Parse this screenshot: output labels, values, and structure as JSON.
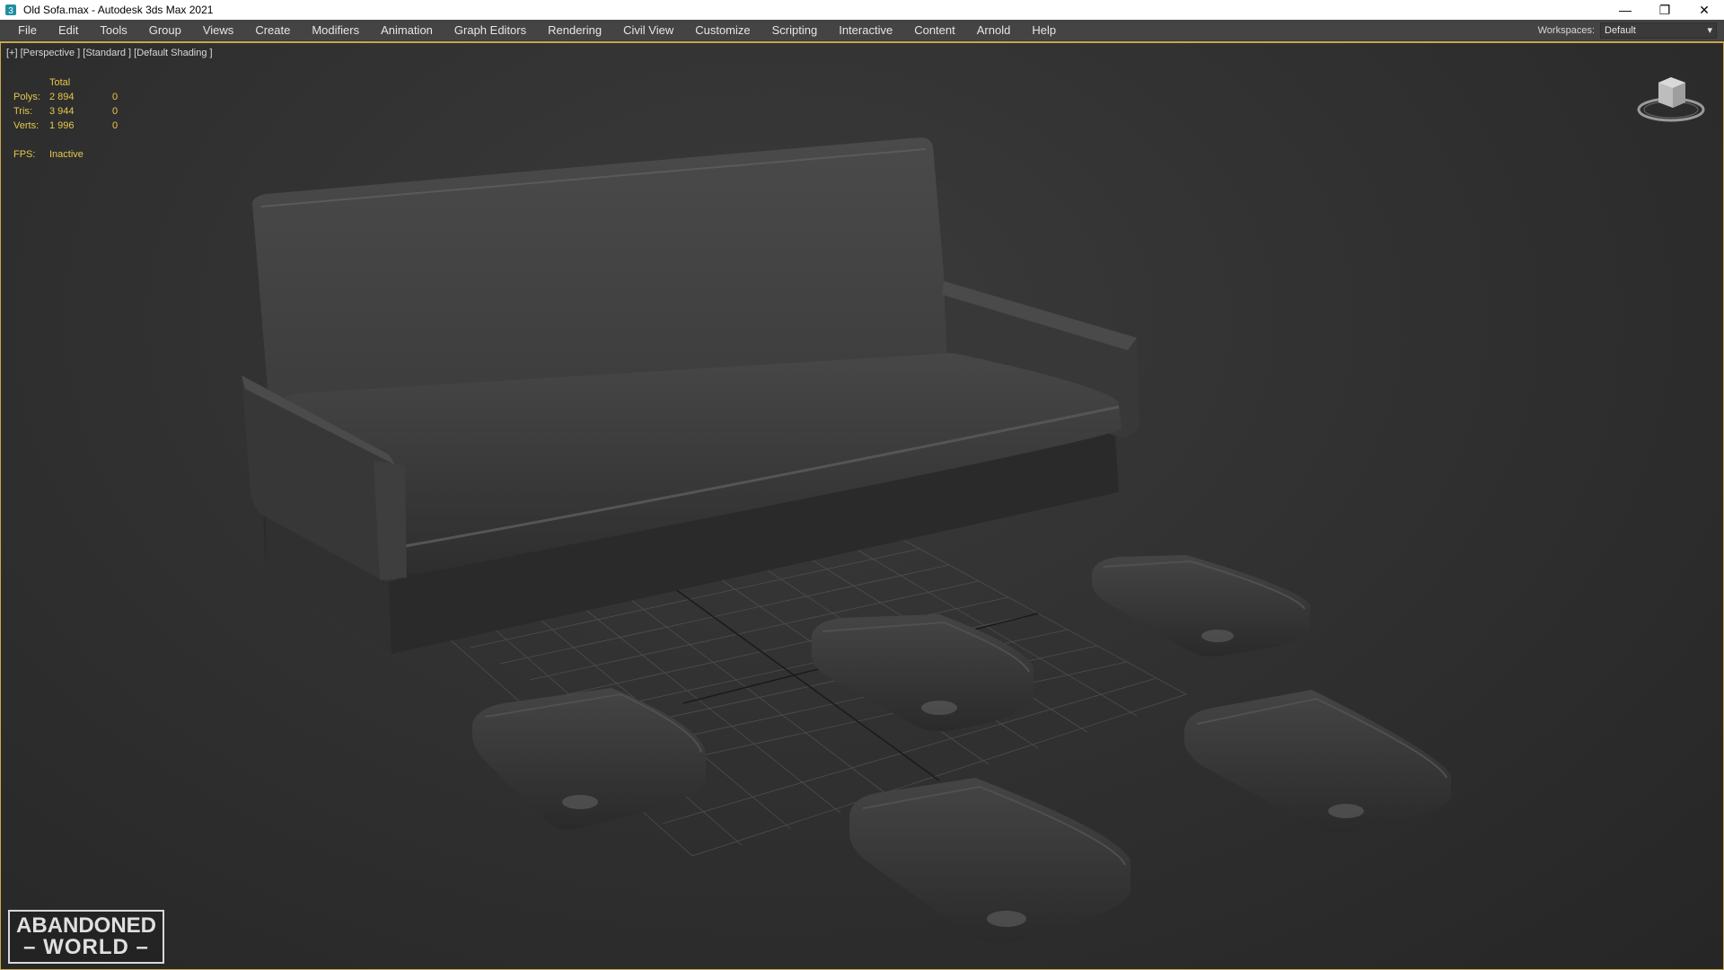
{
  "window": {
    "title": "Old Sofa.max - Autodesk 3ds Max 2021",
    "minimize_glyph": "—",
    "restore_glyph": "❐",
    "close_glyph": "✕"
  },
  "menu": {
    "items": [
      "File",
      "Edit",
      "Tools",
      "Group",
      "Views",
      "Create",
      "Modifiers",
      "Animation",
      "Graph Editors",
      "Rendering",
      "Civil View",
      "Customize",
      "Scripting",
      "Interactive",
      "Content",
      "Arnold",
      "Help"
    ]
  },
  "workspaces": {
    "label": "Workspaces:",
    "value": "Default"
  },
  "viewport": {
    "label": "[+] [Perspective ] [Standard ] [Default Shading ]"
  },
  "stats": {
    "header": "Total",
    "polys_label": "Polys:",
    "polys_total": "2 894",
    "polys_sel": "0",
    "tris_label": "Tris:",
    "tris_total": "3 944",
    "tris_sel": "0",
    "verts_label": "Verts:",
    "verts_total": "1 996",
    "verts_sel": "0",
    "fps_label": "FPS:",
    "fps_value": "Inactive"
  },
  "watermark": {
    "line1": "ABANDONED",
    "line2": "WORLD"
  },
  "colors": {
    "accent": "#c7a84a",
    "stats_text": "#e5c84a",
    "menubar_bg": "#444444",
    "viewport_bg": "#2b2b2b"
  }
}
